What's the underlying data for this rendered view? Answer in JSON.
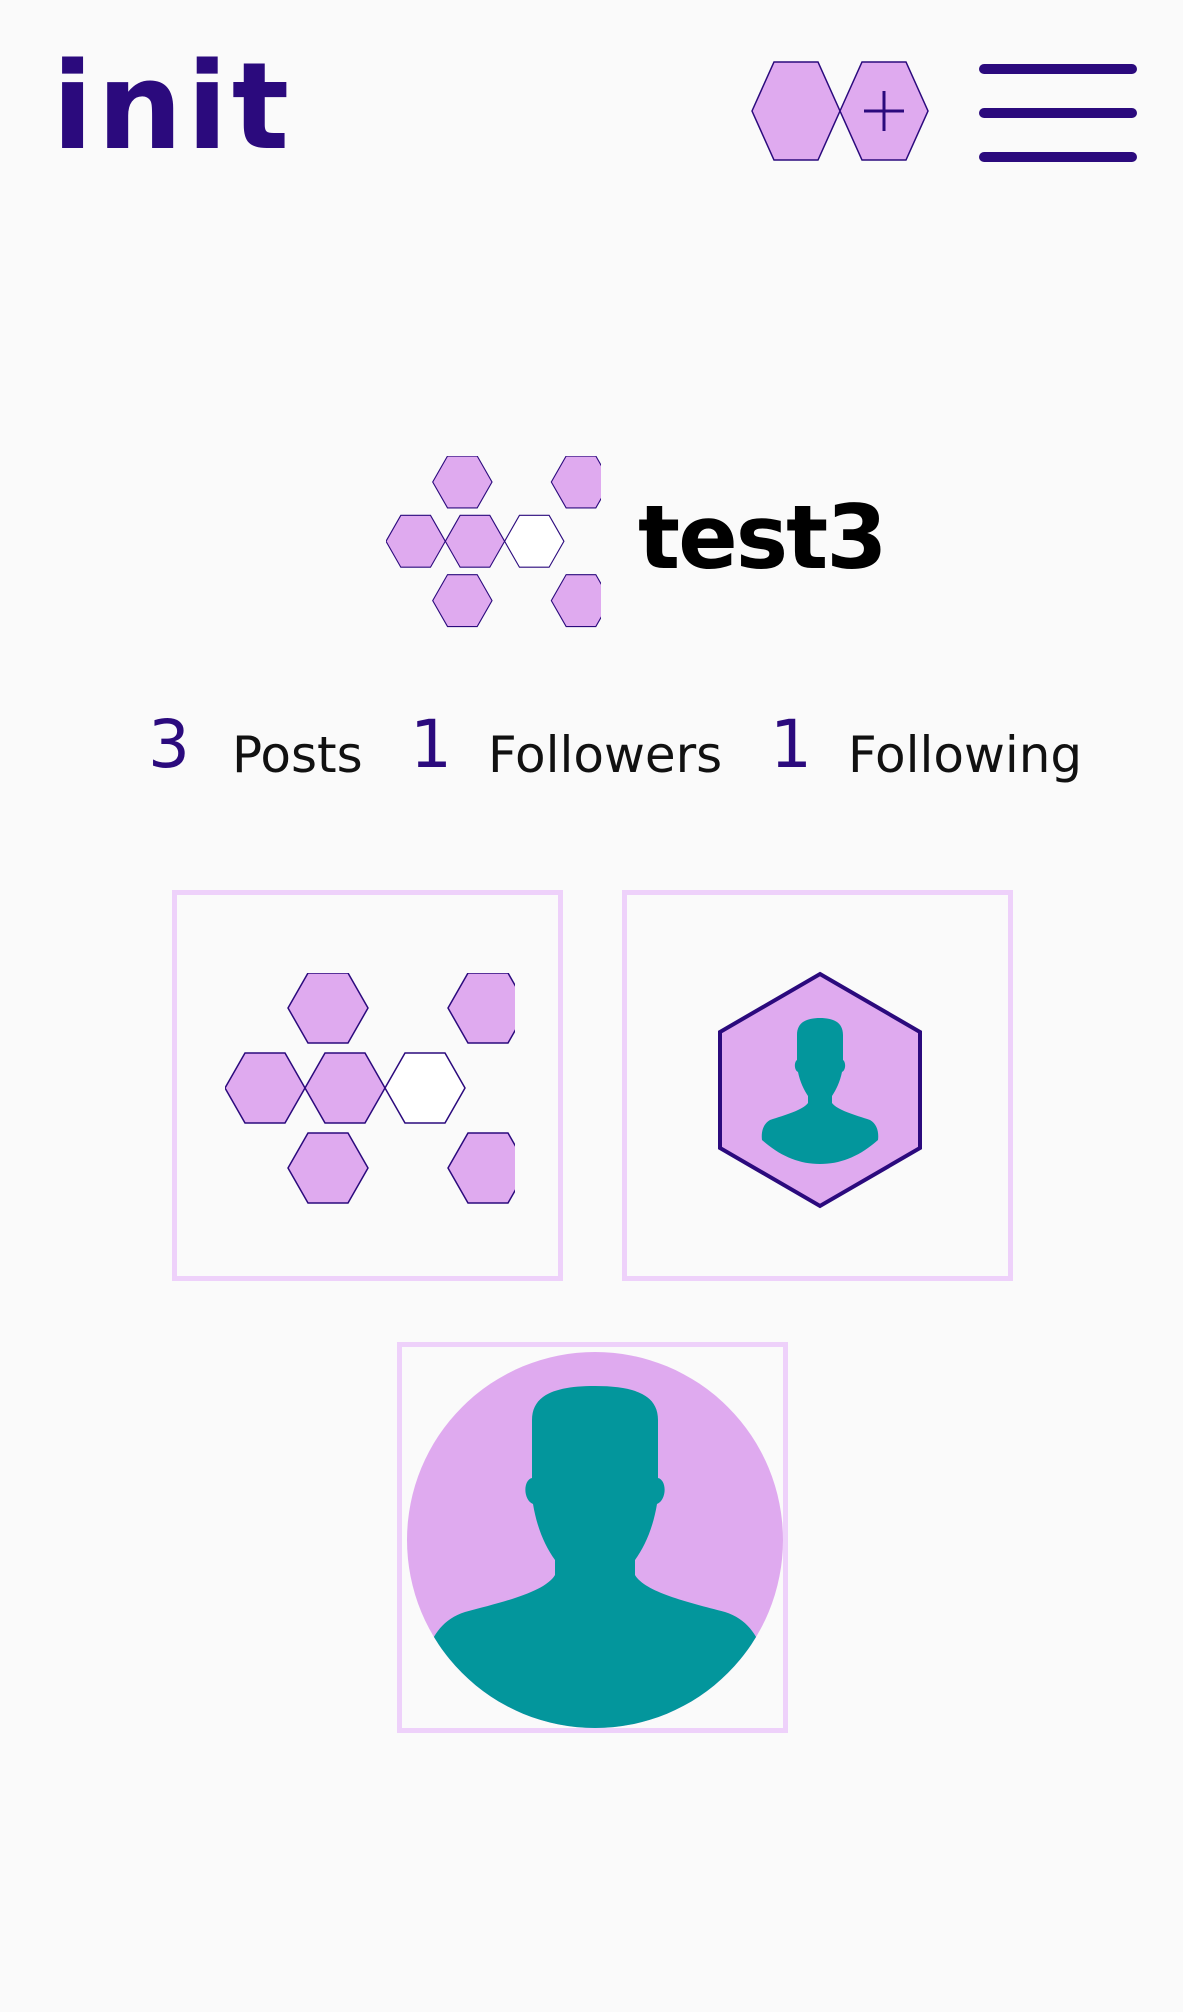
{
  "header": {
    "logo_text": "init",
    "new_post_icon": "hexagon-plus-icon",
    "menu_icon": "hamburger-menu-icon"
  },
  "profile": {
    "username": "test3",
    "avatar_icon": "hexagon-cluster-icon"
  },
  "stats": {
    "posts_count": "3",
    "posts_label": "Posts",
    "followers_count": "1",
    "followers_label": "Followers",
    "following_count": "1",
    "following_label": "Following"
  },
  "posts": [
    {
      "icon": "hexagon-cluster-icon"
    },
    {
      "icon": "hexagon-user-icon"
    },
    {
      "icon": "circle-user-icon"
    }
  ],
  "colors": {
    "accent": "#2b0a7d",
    "hex_fill": "#dfaaef",
    "tile_border": "#eed1fa",
    "silhouette": "#03969c",
    "background": "#fafafa"
  }
}
